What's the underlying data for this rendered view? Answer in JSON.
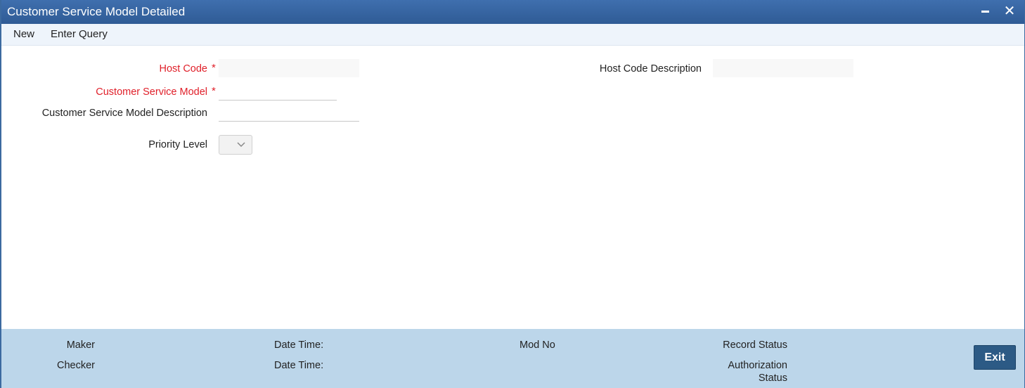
{
  "window": {
    "title": "Customer Service Model Detailed",
    "minimize_label": "",
    "close_label": "✕"
  },
  "toolbar": {
    "new_label": "New",
    "enter_query_label": "Enter Query"
  },
  "form": {
    "host_code_label": "Host Code",
    "host_code_value": "",
    "host_code_description_label": "Host Code Description",
    "host_code_description_value": "",
    "customer_service_model_label": "Customer Service Model",
    "customer_service_model_value": "",
    "customer_service_model_description_label": "Customer Service Model Description",
    "customer_service_model_description_value": "",
    "priority_level_label": "Priority Level",
    "priority_level_value": "",
    "required_marker": "*"
  },
  "footer": {
    "maker_label": "Maker",
    "checker_label": "Checker",
    "date_time_label_1": "Date Time:",
    "date_time_label_2": "Date Time:",
    "mod_no_label": "Mod No",
    "record_status_label": "Record Status",
    "authorization_label": "Authorization",
    "status_label": "Status",
    "exit_label": "Exit"
  },
  "colors": {
    "titlebar": "#2f5b95",
    "required": "#e0202a",
    "footer": "#bcd6ea",
    "exit_button": "#2c5a85"
  }
}
